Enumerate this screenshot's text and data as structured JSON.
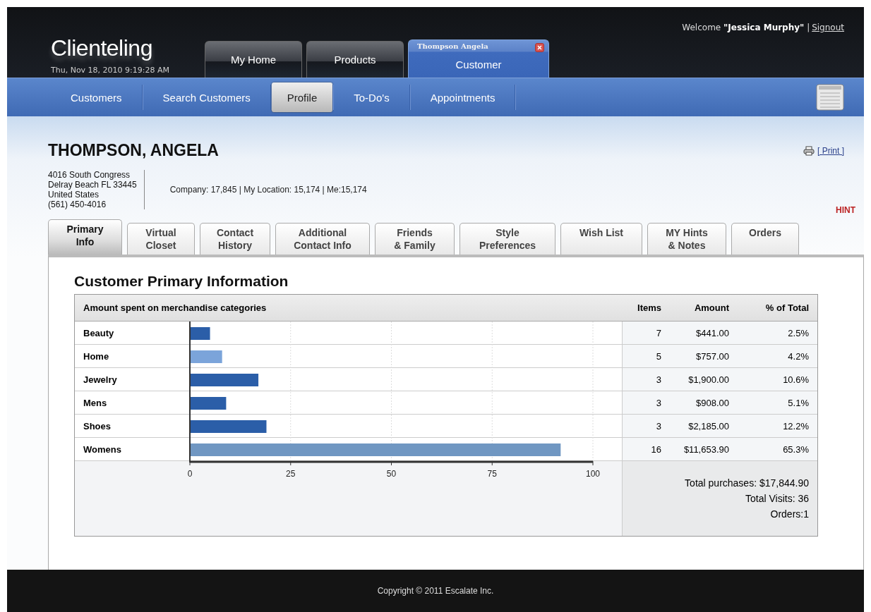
{
  "header": {
    "logo": "Clienteling",
    "datetime": "Thu, Nov 18, 2010 9:19:28 AM",
    "welcome": "Welcome **\"Jessica Murphy\"** |",
    "signout": "Signout"
  },
  "top_tabs": [
    {
      "label": "My Home",
      "selected": false
    },
    {
      "label": "Products",
      "selected": false
    },
    {
      "label": "Customer",
      "subtitle": "Thompson Angela",
      "selected": true,
      "closable": true
    }
  ],
  "nav": [
    {
      "label": "Customers",
      "selected": false
    },
    {
      "label": "Search Customers",
      "selected": false
    },
    {
      "label": "Profile",
      "selected": true
    },
    {
      "label": "To-Do's",
      "selected": false
    },
    {
      "label": "Appointments",
      "selected": false
    }
  ],
  "customer": {
    "name": "THOMPSON, ANGELA",
    "address_lines": [
      "4016 South Congress",
      "Delray Beach FL 33445",
      "United States",
      "(561) 450-4016"
    ],
    "counts": "Company: 17,845 | My Location: 15,174 | Me:15,174",
    "print": "[ Print ]",
    "hint": "HINT"
  },
  "profile_tabs": [
    {
      "lines": [
        "Primary",
        "Info"
      ],
      "selected": true
    },
    {
      "lines": [
        "Virtual",
        "Closet"
      ],
      "selected": false
    },
    {
      "lines": [
        "Contact",
        "History"
      ],
      "selected": false
    },
    {
      "lines": [
        "Additional",
        "Contact Info"
      ],
      "selected": false
    },
    {
      "lines": [
        "Friends",
        "& Family"
      ],
      "selected": false
    },
    {
      "lines": [
        "Style",
        "Preferences"
      ],
      "selected": false
    },
    {
      "lines": [
        "Wish List"
      ],
      "selected": false
    },
    {
      "lines": [
        "MY Hints",
        "& Notes"
      ],
      "selected": false
    },
    {
      "lines": [
        "Orders"
      ],
      "selected": false
    }
  ],
  "section_title": "Customer Primary Information",
  "table": {
    "heading": "Amount spent on merchandise categories",
    "columns": [
      "Items",
      "Amount",
      "% of Total"
    ],
    "rows": [
      {
        "items": "7",
        "amount": "$441.00",
        "percent": "2.5%"
      },
      {
        "items": "5",
        "amount": "$757.00",
        "percent": "4.2%"
      },
      {
        "items": "3",
        "amount": "$1,900.00",
        "percent": "10.6%"
      },
      {
        "items": "3",
        "amount": "$908.00",
        "percent": "5.1%"
      },
      {
        "items": "3",
        "amount": "$2,185.00",
        "percent": "12.2%"
      },
      {
        "items": "16",
        "amount": "$11,653.90",
        "percent": "65.3%"
      }
    ],
    "totals": [
      "Total purchases: $17,844.90",
      "Total Visits: 36",
      "Orders:1"
    ],
    "chart_data": {
      "type": "bar",
      "orientation": "horizontal",
      "categories": [
        "Beauty",
        "Home",
        "Jewelry",
        "Mens",
        "Shoes",
        "Womens"
      ],
      "xlim": [
        0,
        100
      ],
      "xticks": [
        0,
        25,
        50,
        75,
        100
      ],
      "grid": true,
      "series": [
        {
          "colors": [
            "#2b5ea8",
            "#7ba4da",
            "#2b5ea8",
            "#2b5ea8",
            "#2b5ea8",
            "#7097c2"
          ],
          "values": [
            5,
            8,
            17,
            9,
            19,
            92
          ]
        }
      ]
    }
  },
  "footer": "Copyright © 2011 Escalate Inc."
}
